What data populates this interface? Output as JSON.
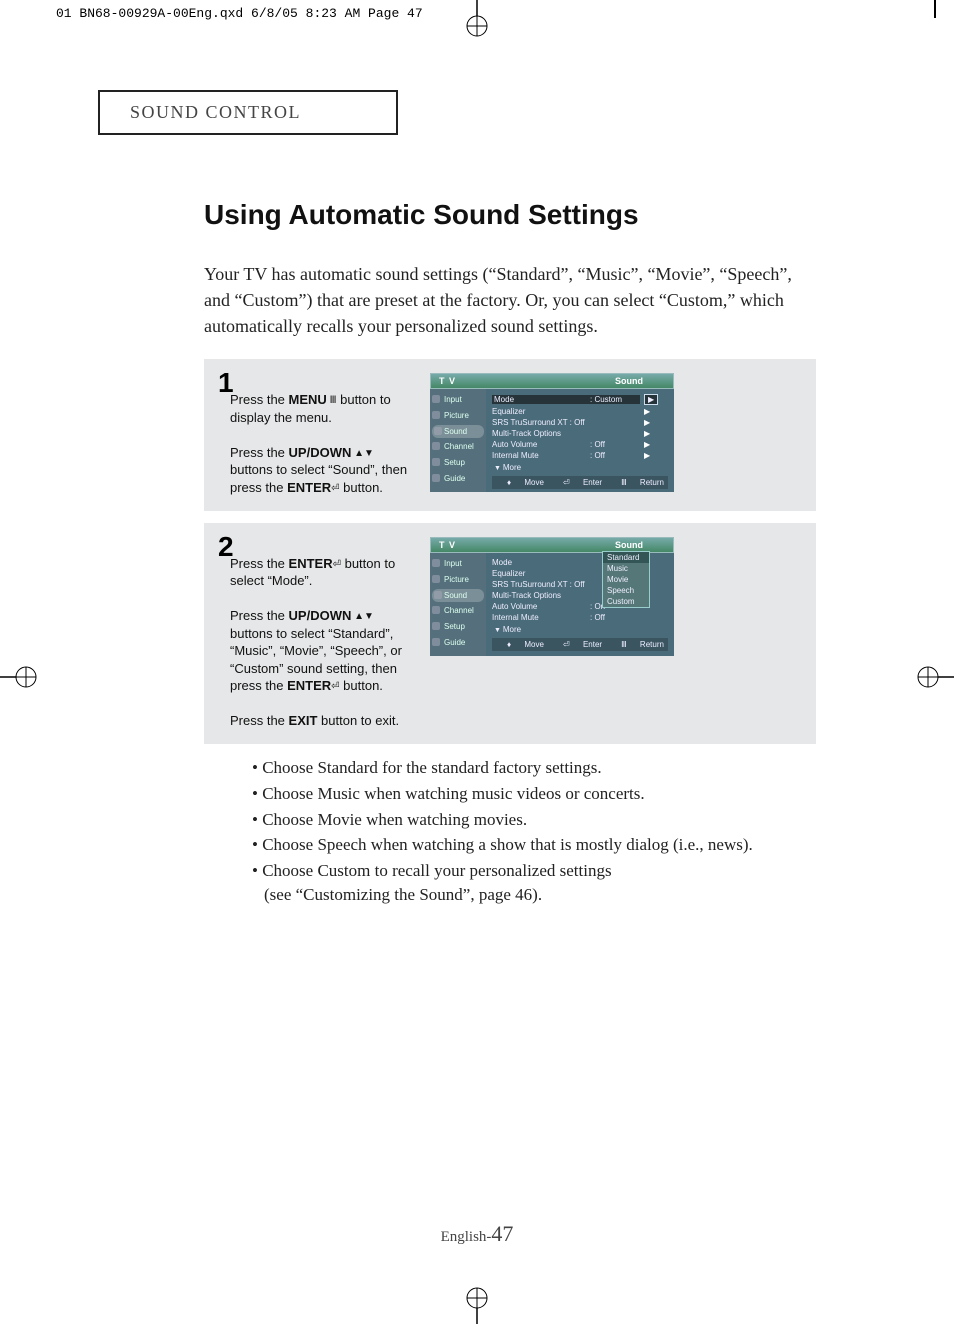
{
  "print_header": "01 BN68-00929A-00Eng.qxd  6/8/05 8:23 AM  Page 47",
  "section_title": "SOUND CONTROL",
  "page_title": "Using Automatic Sound Settings",
  "intro": "Your TV has automatic sound settings (“Standard”, “Music”, “Movie”, “Speech”, and “Custom”) that are preset at the factory. Or, you can select “Custom,” which automatically recalls your personalized sound settings.",
  "step1": {
    "num": "1",
    "line1a": "Press the ",
    "line1b_menu": "MENU",
    "line1c": " button to display the menu.",
    "line2a": "Press the ",
    "line2b_updown": "UP/DOWN",
    "line2c": " buttons to select “Sound”, then press the ",
    "line2d_enter": "ENTER",
    "line2e": " button."
  },
  "step2": {
    "num": "2",
    "line1a": "Press the ",
    "line1b_enter": "ENTER",
    "line1c": "  button to select “Mode”.",
    "line2a": "Press the ",
    "line2b_updown": "UP/DOWN",
    "line2c": " buttons to select “Standard”, “Music”, “Movie”, “Speech”, or “Custom” sound setting, then press the ",
    "line2d_enter": "ENTER",
    "line2e": "  button.",
    "line3a": "Press the ",
    "line3b_exit": "EXIT",
    "line3c": " button to exit."
  },
  "osd": {
    "tv": "T V",
    "title": "Sound",
    "nav": {
      "input": "Input",
      "picture": "Picture",
      "sound": "Sound",
      "channel": "Channel",
      "setup": "Setup",
      "guide": "Guide"
    },
    "rows": {
      "mode": "Mode",
      "mode_val": ": Custom",
      "equalizer": "Equalizer",
      "srs": "SRS TruSurround XT : Off",
      "multitrack": "Multi-Track Options",
      "autovol": "Auto Volume",
      "autovol_val": ": Off",
      "intmute": "Internal Mute",
      "intmute_val": ": Off",
      "more": "More"
    },
    "foot": {
      "move": "Move",
      "enter": "Enter",
      "return": "Return"
    },
    "mode_options": {
      "standard": "Standard",
      "music": "Music",
      "movie": "Movie",
      "speech": "Speech",
      "custom": "Custom"
    },
    "rows2_autovol_val": ": On"
  },
  "tips": {
    "t1": "Choose Standard for the standard factory settings.",
    "t2": "Choose Music when watching music videos or concerts.",
    "t3": "Choose Movie when watching movies.",
    "t4": "Choose Speech when watching a show that is mostly dialog (i.e., news).",
    "t5a": "Choose Custom to recall your personalized settings",
    "t5b": "(see “Customizing the Sound”, page 46)."
  },
  "footer_lang": "English-",
  "footer_num": "47"
}
